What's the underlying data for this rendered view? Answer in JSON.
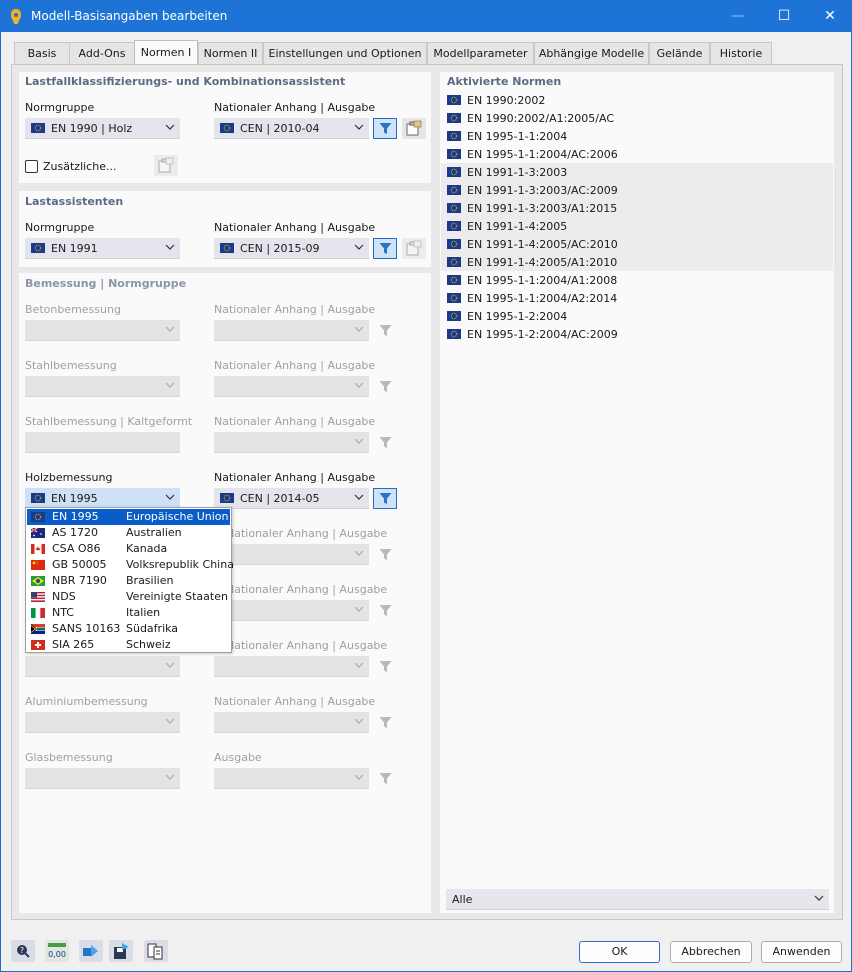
{
  "window": {
    "title": "Modell-Basisangaben bearbeiten"
  },
  "tabs": [
    {
      "label": "Basis"
    },
    {
      "label": "Add-Ons"
    },
    {
      "label": "Normen I"
    },
    {
      "label": "Normen II"
    },
    {
      "label": "Einstellungen und Optionen"
    },
    {
      "label": "Modellparameter"
    },
    {
      "label": "Abhängige Modelle"
    },
    {
      "label": "Gelände"
    },
    {
      "label": "Historie"
    }
  ],
  "lastfall": {
    "title": "Lastfallklassifizierungs- und Kombinationsassistent",
    "norm_label": "Normgruppe",
    "norm_value": "EN 1990 | Holz",
    "annex_label": "Nationaler Anhang | Ausgabe",
    "annex_value": "CEN | 2010-04",
    "extra_label": "Zusätzliche..."
  },
  "last": {
    "title": "Lastassistenten",
    "norm_label": "Normgruppe",
    "norm_value": "EN 1991",
    "annex_label": "Nationaler Anhang | Ausgabe",
    "annex_value": "CEN | 2015-09"
  },
  "bemessung": {
    "title": "Bemessung | Normgruppe",
    "rows": [
      {
        "label": "Betonbemessung",
        "annex_label": "Nationaler Anhang | Ausgabe"
      },
      {
        "label": "Stahlbemessung",
        "annex_label": "Nationaler Anhang | Ausgabe"
      },
      {
        "label": "Stahlbemessung | Kaltgeformt",
        "annex_label": "Nationaler Anhang | Ausgabe"
      },
      {
        "label": "Holzbemessung",
        "annex_label": "Nationaler Anhang | Ausgabe",
        "value": "EN 1995",
        "annex_value": "CEN | 2014-05"
      },
      {
        "label": "",
        "annex_label": "Nationaler Anhang | Ausgabe"
      },
      {
        "label": "",
        "annex_label": "Nationaler Anhang | Ausgabe"
      },
      {
        "label": "",
        "annex_label": "Nationaler Anhang | Ausgabe"
      },
      {
        "label": "Aluminiumbemessung",
        "annex_label": "Nationaler Anhang | Ausgabe"
      },
      {
        "label": "Glasbemessung",
        "annex_label": "Ausgabe"
      }
    ]
  },
  "dropdown": [
    {
      "code": "EN 1995",
      "country": "Europäische Union",
      "flag": "eu"
    },
    {
      "code": "AS 1720",
      "country": "Australien",
      "flag": "au"
    },
    {
      "code": "CSA O86",
      "country": "Kanada",
      "flag": "ca"
    },
    {
      "code": "GB 50005",
      "country": "Volksrepublik China",
      "flag": "cn"
    },
    {
      "code": "NBR 7190",
      "country": "Brasilien",
      "flag": "br"
    },
    {
      "code": "NDS",
      "country": "Vereinigte Staaten",
      "flag": "us"
    },
    {
      "code": "NTC",
      "country": "Italien",
      "flag": "it"
    },
    {
      "code": "SANS 10163",
      "country": "Südafrika",
      "flag": "za"
    },
    {
      "code": "SIA 265",
      "country": "Schweiz",
      "flag": "ch"
    }
  ],
  "aktivierte": {
    "title": "Aktivierte Normen",
    "items": [
      "EN 1990:2002",
      "EN 1990:2002/A1:2005/AC",
      "EN 1995-1-1:2004",
      "EN 1995-1-1:2004/AC:2006",
      "EN 1991-1-3:2003",
      "EN 1991-1-3:2003/AC:2009",
      "EN 1991-1-3:2003/A1:2015",
      "EN 1991-1-4:2005",
      "EN 1991-1-4:2005/AC:2010",
      "EN 1991-1-4:2005/A1:2010",
      "EN 1995-1-1:2004/A1:2008",
      "EN 1995-1-1:2004/A2:2014",
      "EN 1995-1-2:2004",
      "EN 1995-1-2:2004/AC:2009"
    ],
    "filter_value": "Alle"
  },
  "buttons": {
    "ok": "OK",
    "cancel": "Abbrechen",
    "apply": "Anwenden"
  },
  "colors": {
    "titlebar": "#1e74d6",
    "accent": "#0a5cc8",
    "section": "#5a6b85"
  }
}
